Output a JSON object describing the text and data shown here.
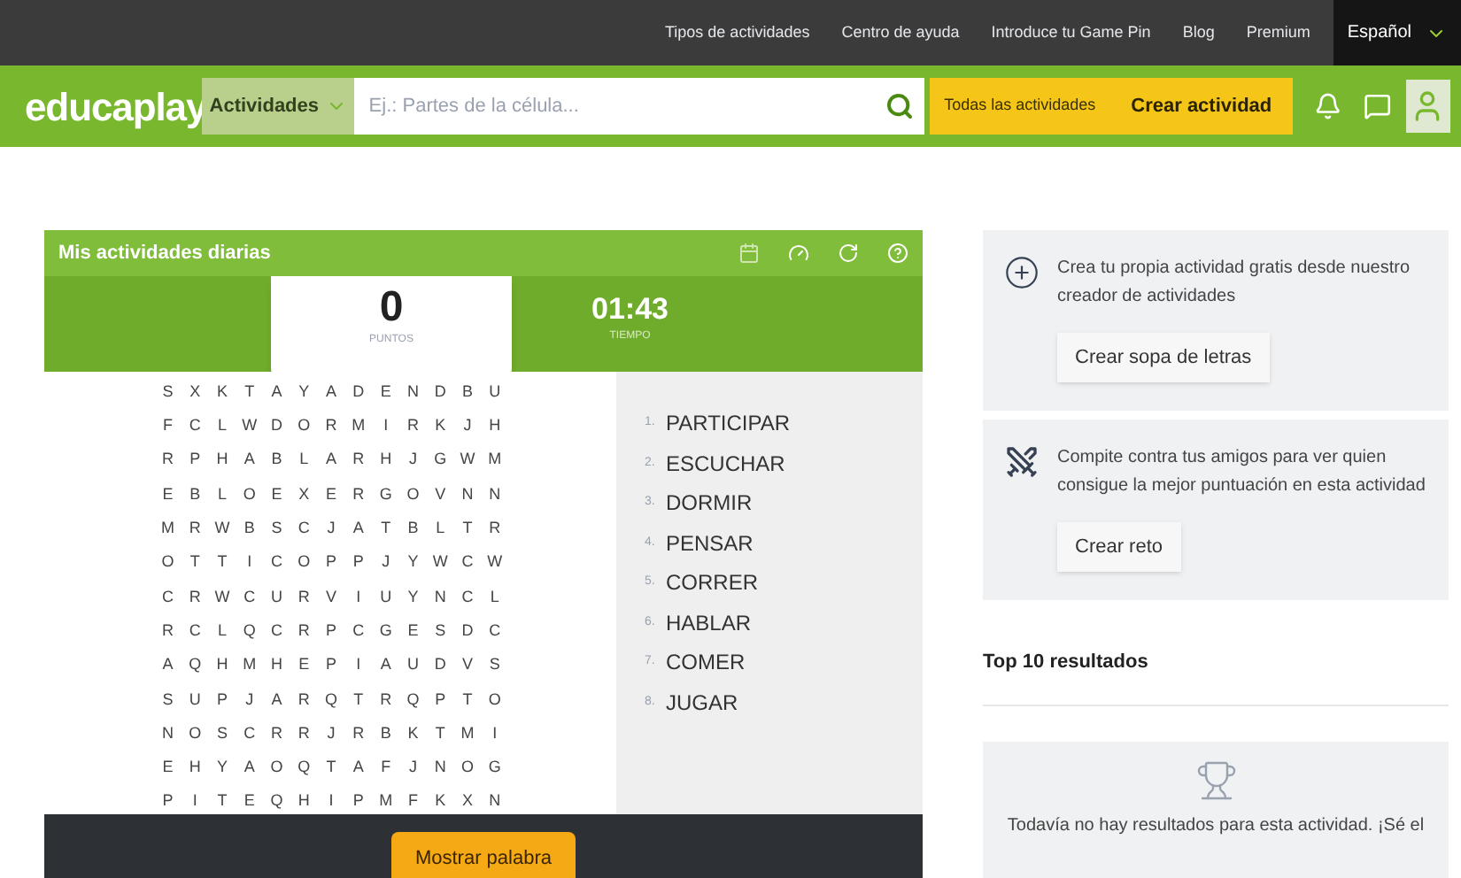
{
  "top_links": [
    "Tipos de actividades",
    "Centro de ayuda",
    "Introduce tu Game Pin",
    "Blog",
    "Premium"
  ],
  "language": "Español",
  "logo": "educaplay",
  "category_select": "Actividades",
  "search": {
    "placeholder": "Ej.: Partes de la célula..."
  },
  "all_activities_button": "Todas las actividades",
  "create_button": "Crear actividad",
  "game": {
    "title": "Mis actividades diarias",
    "score": "0",
    "score_label": "PUNTOS",
    "time": "01:43",
    "time_label": "TIEMPO",
    "grid": [
      [
        "S",
        "X",
        "K",
        "T",
        "A",
        "Y",
        "A",
        "D",
        "E",
        "N",
        "D",
        "B",
        "U"
      ],
      [
        "F",
        "C",
        "L",
        "W",
        "D",
        "O",
        "R",
        "M",
        "I",
        "R",
        "K",
        "J",
        "H"
      ],
      [
        "R",
        "P",
        "H",
        "A",
        "B",
        "L",
        "A",
        "R",
        "H",
        "J",
        "G",
        "W",
        "M"
      ],
      [
        "E",
        "B",
        "L",
        "O",
        "E",
        "X",
        "E",
        "R",
        "G",
        "O",
        "V",
        "N",
        "N"
      ],
      [
        "M",
        "R",
        "W",
        "B",
        "S",
        "C",
        "J",
        "A",
        "T",
        "B",
        "L",
        "T",
        "R"
      ],
      [
        "O",
        "T",
        "T",
        "I",
        "C",
        "O",
        "P",
        "P",
        "J",
        "Y",
        "W",
        "C",
        "W"
      ],
      [
        "C",
        "R",
        "W",
        "C",
        "U",
        "R",
        "V",
        "I",
        "U",
        "Y",
        "N",
        "C",
        "L"
      ],
      [
        "R",
        "C",
        "L",
        "Q",
        "C",
        "R",
        "P",
        "C",
        "G",
        "E",
        "S",
        "D",
        "C"
      ],
      [
        "A",
        "Q",
        "H",
        "M",
        "H",
        "E",
        "P",
        "I",
        "A",
        "U",
        "D",
        "V",
        "S"
      ],
      [
        "S",
        "U",
        "P",
        "J",
        "A",
        "R",
        "Q",
        "T",
        "R",
        "Q",
        "P",
        "T",
        "O"
      ],
      [
        "N",
        "O",
        "S",
        "C",
        "R",
        "R",
        "J",
        "R",
        "B",
        "K",
        "T",
        "M",
        "I"
      ],
      [
        "E",
        "H",
        "Y",
        "A",
        "O",
        "Q",
        "T",
        "A",
        "F",
        "J",
        "N",
        "O",
        "G"
      ],
      [
        "P",
        "I",
        "T",
        "E",
        "Q",
        "H",
        "I",
        "P",
        "M",
        "F",
        "K",
        "X",
        "N"
      ]
    ],
    "words": [
      {
        "number": "1.",
        "word": "PARTICIPAR"
      },
      {
        "number": "2.",
        "word": "ESCUCHAR"
      },
      {
        "number": "3.",
        "word": "DORMIR"
      },
      {
        "number": "4.",
        "word": "PENSAR"
      },
      {
        "number": "5.",
        "word": "CORRER"
      },
      {
        "number": "6.",
        "word": "HABLAR"
      },
      {
        "number": "7.",
        "word": "COMER"
      },
      {
        "number": "8.",
        "word": "JUGAR"
      }
    ],
    "show_word_button": "Mostrar palabra"
  },
  "side_cards": [
    {
      "kind": "create",
      "text": "Crea tu propia actividad gratis desde nuestro creador de actividades",
      "button": "Crear sopa de letras"
    },
    {
      "kind": "challenge",
      "text": "Compite contra tus amigos para ver quien consigue la mejor puntuación en esta actividad",
      "button": "Crear reto"
    }
  ],
  "top_results": {
    "title": "Top 10 resultados",
    "empty_text": "Todavía no hay resultados para esta actividad. ¡Sé el"
  }
}
